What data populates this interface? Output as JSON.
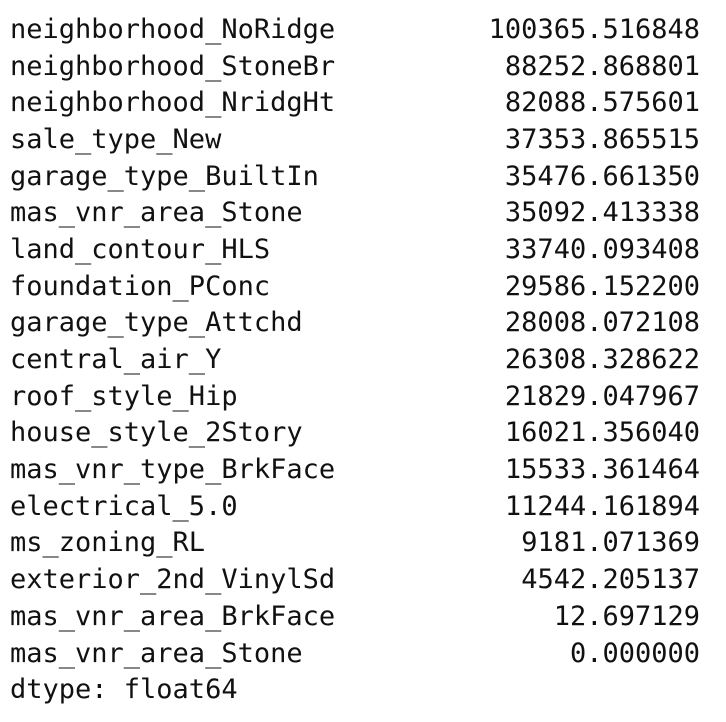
{
  "rows": [
    {
      "label": "neighborhood_NoRidge",
      "value": "100365.516848"
    },
    {
      "label": "neighborhood_StoneBr",
      "value": "88252.868801"
    },
    {
      "label": "neighborhood_NridgHt",
      "value": "82088.575601"
    },
    {
      "label": "sale_type_New",
      "value": "37353.865515"
    },
    {
      "label": "garage_type_BuiltIn",
      "value": "35476.661350"
    },
    {
      "label": "mas_vnr_area_Stone",
      "value": "35092.413338"
    },
    {
      "label": "land_contour_HLS",
      "value": "33740.093408"
    },
    {
      "label": "foundation_PConc",
      "value": "29586.152200"
    },
    {
      "label": "garage_type_Attchd",
      "value": "28008.072108"
    },
    {
      "label": "central_air_Y",
      "value": "26308.328622"
    },
    {
      "label": "roof_style_Hip",
      "value": "21829.047967"
    },
    {
      "label": "house_style_2Story",
      "value": "16021.356040"
    },
    {
      "label": "mas_vnr_type_BrkFace",
      "value": "15533.361464"
    },
    {
      "label": "electrical_5.0",
      "value": "11244.161894"
    },
    {
      "label": "ms_zoning_RL",
      "value": "9181.071369"
    },
    {
      "label": "exterior_2nd_VinylSd",
      "value": "4542.205137"
    },
    {
      "label": "mas_vnr_area_BrkFace",
      "value": "12.697129"
    },
    {
      "label": "mas_vnr_area_Stone",
      "value": "0.000000"
    }
  ],
  "dtype_line": "dtype: float64"
}
